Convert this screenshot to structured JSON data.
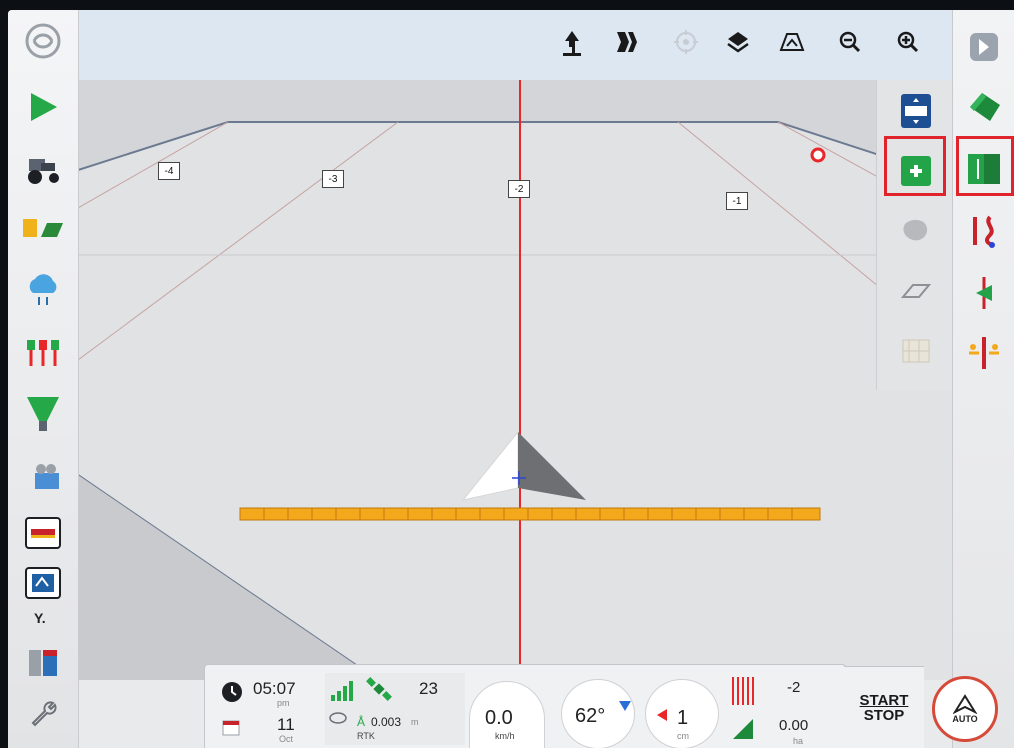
{
  "toolbar": {
    "icons": [
      "hand-pointer-icon",
      "swath-pattern-icon",
      "gps-target-icon",
      "layers-icon",
      "view-perspective-icon",
      "zoom-out-icon",
      "zoom-in-icon"
    ]
  },
  "leftbar": {
    "icons": [
      "app-logo-icon",
      "guidance-arrow-icon",
      "tractor-icon",
      "implement-icon",
      "cloud-sync-icon",
      "section-control-icon",
      "spreader-icon",
      "video-camera-icon",
      "boom-section-icon",
      "isobus-icon",
      "product-tanks-icon",
      "wrench-icon"
    ],
    "expand_label": "Y."
  },
  "field": {
    "markers": [
      "-4",
      "-3",
      "-2",
      "-1"
    ],
    "colors": {
      "guideline": "#e8272b",
      "boom": "#f4a81c",
      "ground": "#d4d5d8"
    }
  },
  "status": {
    "clock": {
      "time": "05:07",
      "ampm": "pm",
      "day": "11",
      "month": "Oct"
    },
    "satellites": "23",
    "accuracy_value": "0.003",
    "accuracy_unit": "m",
    "correction": "RTK",
    "speed": "0.0",
    "speed_unit": "km/h",
    "heading": "62°",
    "offset": "1",
    "offset_unit": "cm",
    "line_number": "-2",
    "area": "0.00",
    "area_unit": "ha"
  },
  "controls": {
    "start_label": "START",
    "stop_label": "STOP",
    "auto_label": "AUTO"
  }
}
